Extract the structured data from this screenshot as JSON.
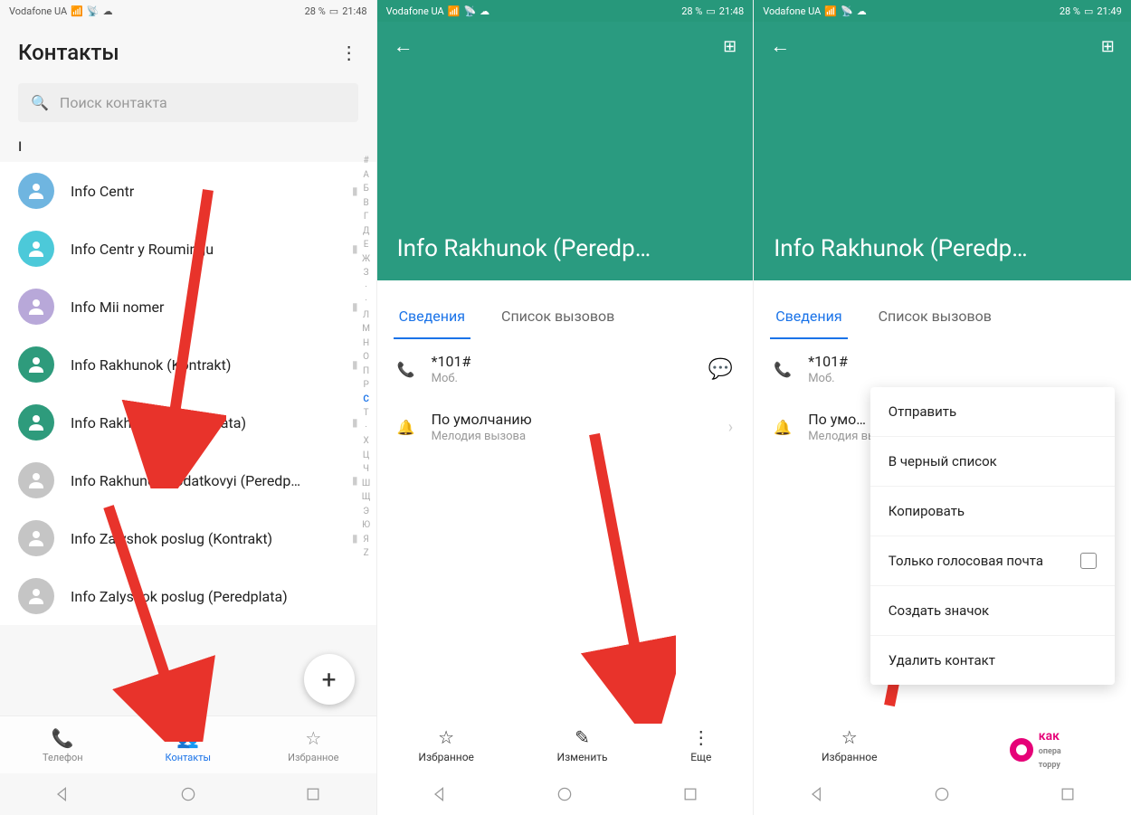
{
  "status": {
    "carrier": "Vodafone UA",
    "battery": "28 %",
    "time1": "21:48",
    "time2": "21:49"
  },
  "s1": {
    "title": "Контакты",
    "search_placeholder": "Поиск контакта",
    "section": "I",
    "contacts": [
      "Info Centr",
      "Info Centr y Roumingu",
      "Info Mii nomer",
      "Info Rakhunok (Kontrakt)",
      "Info Rakhunok (Peredplata)",
      "Info Rakhunok dodatkovyi (Peredp…",
      "Info Zalyshok poslug (Kontrakt)",
      "Info Zalyshok poslug (Peredplata)"
    ],
    "alpha": [
      "#",
      "А",
      "Б",
      "В",
      "Г",
      "Д",
      "Е",
      "Ж",
      "З",
      "·",
      "·",
      "Л",
      "М",
      "Н",
      "О",
      "П",
      "Р",
      "С",
      "Т",
      "·",
      "Х",
      "Ц",
      "Ч",
      "Ш",
      "Щ",
      "Э",
      "Ю",
      "Я",
      "Z"
    ],
    "nav": {
      "phone": "Телефон",
      "contacts": "Контакты",
      "fav": "Избранное"
    }
  },
  "detail": {
    "name": "Info Rakhunok (Peredp…",
    "tabs": {
      "info": "Сведения",
      "calls": "Список вызовов"
    },
    "phone": "*101#",
    "phone_sub": "Моб.",
    "ringtone": "По умолчанию",
    "ringtone_sub": "Мелодия вызова",
    "ringtone_short": "По умо…",
    "nav": {
      "fav": "Избранное",
      "edit": "Изменить",
      "more": "Еще"
    }
  },
  "menu": {
    "send": "Отправить",
    "blacklist": "В черный список",
    "copy": "Копировать",
    "voicemail": "Только голосовая почта",
    "shortcut": "Создать значок",
    "delete": "Удалить контакт"
  },
  "watermark": {
    "t1": "как",
    "t2": "опера",
    "t3": "тор",
    "suf": "ру"
  }
}
